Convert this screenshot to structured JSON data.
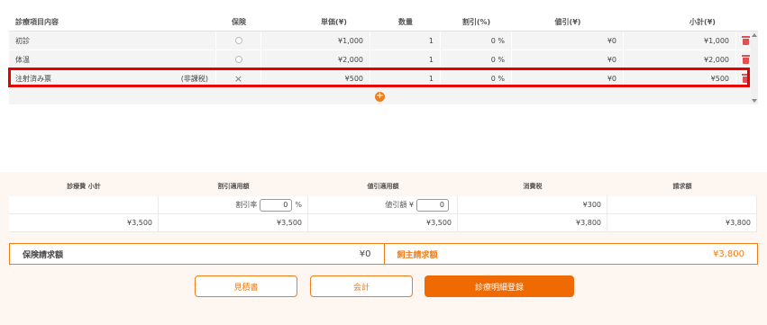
{
  "table": {
    "headers": {
      "name": "診療項目内容",
      "insurance": "保険",
      "unit_price": "単価(¥)",
      "quantity": "数量",
      "discount_rate": "割引(%)",
      "discount_amount": "値引(¥)",
      "subtotal": "小計(¥)"
    },
    "rows": [
      {
        "name": "初診",
        "tax_note": "",
        "insurance": "○",
        "unit_price": "¥1,000",
        "quantity": "1",
        "discount_rate": "0 %",
        "discount_amount": "¥0",
        "subtotal": "¥1,000"
      },
      {
        "name": "体温",
        "tax_note": "",
        "insurance": "○",
        "unit_price": "¥2,000",
        "quantity": "1",
        "discount_rate": "0 %",
        "discount_amount": "¥0",
        "subtotal": "¥2,000"
      },
      {
        "name": "注射済み票",
        "tax_note": "(非課税)",
        "insurance": "×",
        "unit_price": "¥500",
        "quantity": "1",
        "discount_rate": "0 %",
        "discount_amount": "¥0",
        "subtotal": "¥500"
      }
    ],
    "add_icon": "plus-circle-icon",
    "delete_icon": "trash-icon"
  },
  "summary": {
    "headers": {
      "subtotal": "診療費 小計",
      "discount_applied": "割引適用額",
      "reduction_applied": "値引適用額",
      "tax": "消費税",
      "billed": "請求額"
    },
    "discount_rate_label": "割引率",
    "discount_rate_value": "0",
    "discount_rate_unit": "%",
    "reduction_label": "値引額 ¥",
    "reduction_value": "0",
    "tax_row1": "¥300",
    "row2": {
      "subtotal": "¥3,500",
      "discount_applied": "¥3,500",
      "reduction_applied": "¥3,500",
      "tax": "¥3,800",
      "billed": "¥3,800"
    }
  },
  "totals": {
    "insurance_label": "保険請求額",
    "insurance_value": "¥0",
    "owner_label": "飼主請求額",
    "owner_value": "¥3,800"
  },
  "buttons": {
    "estimate": "見積書",
    "checkout": "会計",
    "register": "診療明細登録"
  },
  "colors": {
    "accent": "#ef7d1a",
    "highlight": "#e60000",
    "delete": "#e05050"
  }
}
